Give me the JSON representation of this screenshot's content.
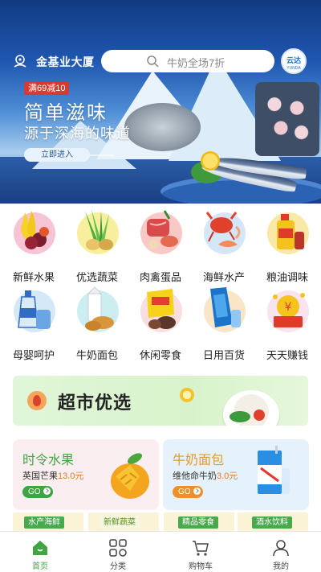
{
  "header": {
    "location": "金基业大厦",
    "search_placeholder": "牛奶全场7折",
    "brand_logo_text": "云达",
    "brand_logo_sub": "YUNDA"
  },
  "banner": {
    "promo_tag": "满69减10",
    "title": "简单滋味",
    "subtitle": "源于深海的味道",
    "button": "立即进入"
  },
  "categories": [
    {
      "label": "新鲜水果",
      "icon": "fruit-icon"
    },
    {
      "label": "优选蔬菜",
      "icon": "vegetable-icon"
    },
    {
      "label": "肉禽蛋品",
      "icon": "meat-icon"
    },
    {
      "label": "海鲜水产",
      "icon": "seafood-icon"
    },
    {
      "label": "粮油调味",
      "icon": "oil-icon"
    },
    {
      "label": "母婴呵护",
      "icon": "baby-care-icon"
    },
    {
      "label": "牛奶面包",
      "icon": "milk-bread-icon"
    },
    {
      "label": "休闲零食",
      "icon": "snack-icon"
    },
    {
      "label": "日用百货",
      "icon": "daily-goods-icon"
    },
    {
      "label": "天天赚钱",
      "icon": "earn-money-icon"
    }
  ],
  "supermarket": {
    "title": "超市优选"
  },
  "promo_cards": [
    {
      "title": "时令水果",
      "desc": "英国芒果",
      "price": "13.0元",
      "go": "GO"
    },
    {
      "title": "牛奶面包",
      "desc": "维他命牛奶",
      "price": "3.0元",
      "go": "GO"
    }
  ],
  "section_tags": [
    "水产海鲜",
    "新鲜蔬菜",
    "精品零食",
    "酒水饮料"
  ],
  "tabbar": [
    {
      "label": "首页",
      "icon": "home-icon",
      "active": true
    },
    {
      "label": "分类",
      "icon": "category-icon",
      "active": false
    },
    {
      "label": "购物车",
      "icon": "cart-icon",
      "active": false
    },
    {
      "label": "我的",
      "icon": "profile-icon",
      "active": false
    }
  ],
  "colors": {
    "accent_green": "#3fa543",
    "promo_red": "#d73b2f",
    "price_orange": "#e07a2e",
    "milk_orange": "#ec9128"
  }
}
